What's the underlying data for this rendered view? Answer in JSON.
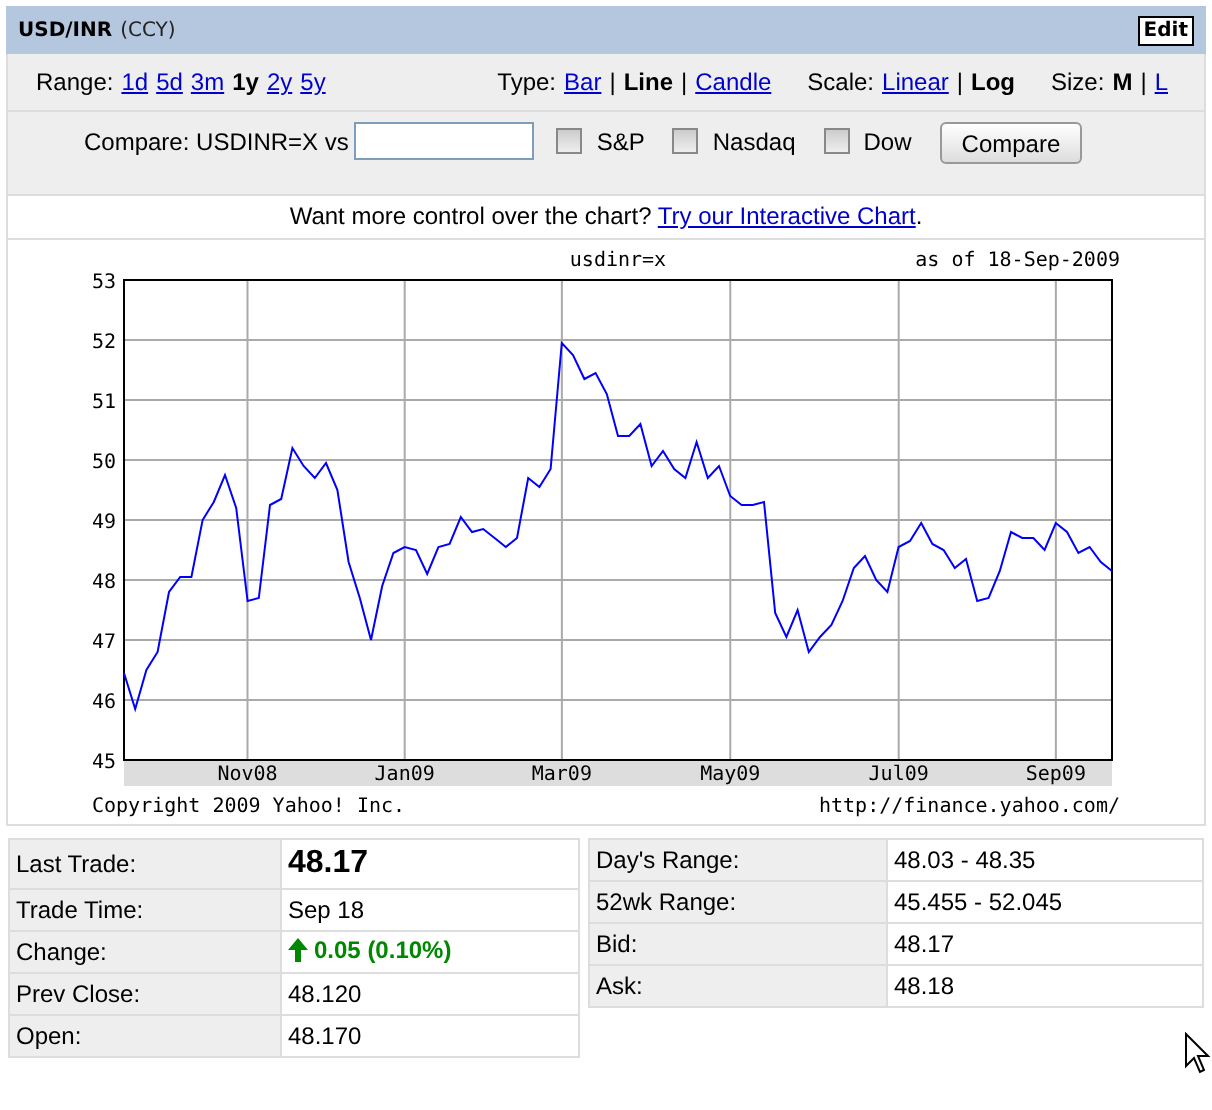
{
  "header": {
    "title": "USD/INR",
    "subtitle": "(CCY)",
    "edit_button": "Edit"
  },
  "controls": [
    {
      "label": "Range:",
      "options": [
        {
          "label": "1d",
          "selected": false
        },
        {
          "label": "5d",
          "selected": false
        },
        {
          "label": "3m",
          "selected": false
        },
        {
          "label": "1y",
          "selected": true
        },
        {
          "label": "2y",
          "selected": false
        },
        {
          "label": "5y",
          "selected": false
        }
      ]
    },
    {
      "label": "Type:",
      "separator": "|",
      "options": [
        {
          "label": "Bar",
          "selected": false
        },
        {
          "label": "Line",
          "selected": true
        },
        {
          "label": "Candle",
          "selected": false
        }
      ]
    },
    {
      "label": "Scale:",
      "separator": "|",
      "options": [
        {
          "label": "Linear",
          "selected": false
        },
        {
          "label": "Log",
          "selected": true
        }
      ]
    },
    {
      "label": "Size:",
      "separator": "|",
      "options": [
        {
          "label": "M",
          "selected": true
        },
        {
          "label": "L",
          "selected": false
        }
      ]
    }
  ],
  "compare": {
    "label": "Compare: USDINR=X vs",
    "checkboxes": [
      {
        "label": "S&P",
        "checked": false
      },
      {
        "label": "Nasdaq",
        "checked": false
      },
      {
        "label": "Dow",
        "checked": false
      }
    ],
    "button": "Compare"
  },
  "promo": {
    "text": "Want more control over the chart?",
    "link": "Try our Interactive Chart",
    "suffix": "."
  },
  "chart": {
    "symbol": "usdinr=x",
    "as_of": "as of 18-Sep-2009",
    "copyright": "Copyright 2009 Yahoo! Inc.",
    "url": "http://finance.yahoo.com/",
    "chart_data": {
      "type": "line",
      "grid": true,
      "categories": [
        null,
        null,
        null,
        null,
        null,
        null,
        null,
        null,
        null,
        null,
        null,
        "Nov08",
        null,
        null,
        null,
        null,
        null,
        null,
        null,
        null,
        null,
        null,
        null,
        null,
        null,
        "Jan09",
        null,
        null,
        null,
        null,
        null,
        null,
        null,
        null,
        null,
        null,
        null,
        null,
        null,
        "Mar09",
        null,
        null,
        null,
        null,
        null,
        null,
        null,
        null,
        null,
        null,
        null,
        null,
        null,
        null,
        "May09",
        null,
        null,
        null,
        null,
        null,
        null,
        null,
        null,
        null,
        null,
        null,
        null,
        null,
        null,
        "Jul09",
        null,
        null,
        null,
        null,
        null,
        null,
        null,
        null,
        null,
        null,
        null,
        null,
        null,
        "Sep09",
        null,
        null,
        null,
        null,
        null
      ],
      "ylim": [
        45,
        53
      ],
      "yticks": [
        45,
        46,
        47,
        48,
        49,
        50,
        51,
        52,
        53
      ],
      "series": [
        {
          "color": "#0000ff",
          "values": [
            46.45,
            45.85,
            46.5,
            46.8,
            47.8,
            48.05,
            48.05,
            49.0,
            49.3,
            49.75,
            49.2,
            47.65,
            47.7,
            49.25,
            49.35,
            50.2,
            49.9,
            49.7,
            49.95,
            49.5,
            48.3,
            47.7,
            47.0,
            47.9,
            48.45,
            48.55,
            48.5,
            48.1,
            48.55,
            48.6,
            49.05,
            48.8,
            48.85,
            48.7,
            48.55,
            48.7,
            49.7,
            49.55,
            49.85,
            51.95,
            51.75,
            51.35,
            51.45,
            51.1,
            50.4,
            50.4,
            50.6,
            49.9,
            50.15,
            49.85,
            49.7,
            50.3,
            49.7,
            49.9,
            49.4,
            49.25,
            49.25,
            49.3,
            47.45,
            47.05,
            47.5,
            46.8,
            47.05,
            47.25,
            47.65,
            48.2,
            48.4,
            48.0,
            47.8,
            48.55,
            48.65,
            48.95,
            48.6,
            48.5,
            48.2,
            48.35,
            47.65,
            47.7,
            48.15,
            48.8,
            48.7,
            48.7,
            48.5,
            48.95,
            48.8,
            48.45,
            48.55,
            48.3,
            48.15
          ]
        }
      ]
    }
  },
  "quote_left": [
    {
      "kind": "big",
      "label": "Last Trade:",
      "value": "48.17"
    },
    {
      "kind": "plain",
      "label": "Trade Time:",
      "value": "Sep 18"
    },
    {
      "kind": "change",
      "label": "Change:",
      "value": "0.05 (0.10%)"
    },
    {
      "kind": "plain",
      "label": "Prev Close:",
      "value": "48.120"
    },
    {
      "kind": "plain",
      "label": "Open:",
      "value": "48.170"
    }
  ],
  "quote_right": [
    {
      "kind": "plain",
      "label": "Day's Range:",
      "value": "48.03 - 48.35"
    },
    {
      "kind": "plain",
      "label": "52wk Range:",
      "value": "45.455 - 52.045"
    },
    {
      "kind": "plain",
      "label": "Bid:",
      "value": "48.17"
    },
    {
      "kind": "plain",
      "label": "Ask:",
      "value": "48.18"
    }
  ]
}
